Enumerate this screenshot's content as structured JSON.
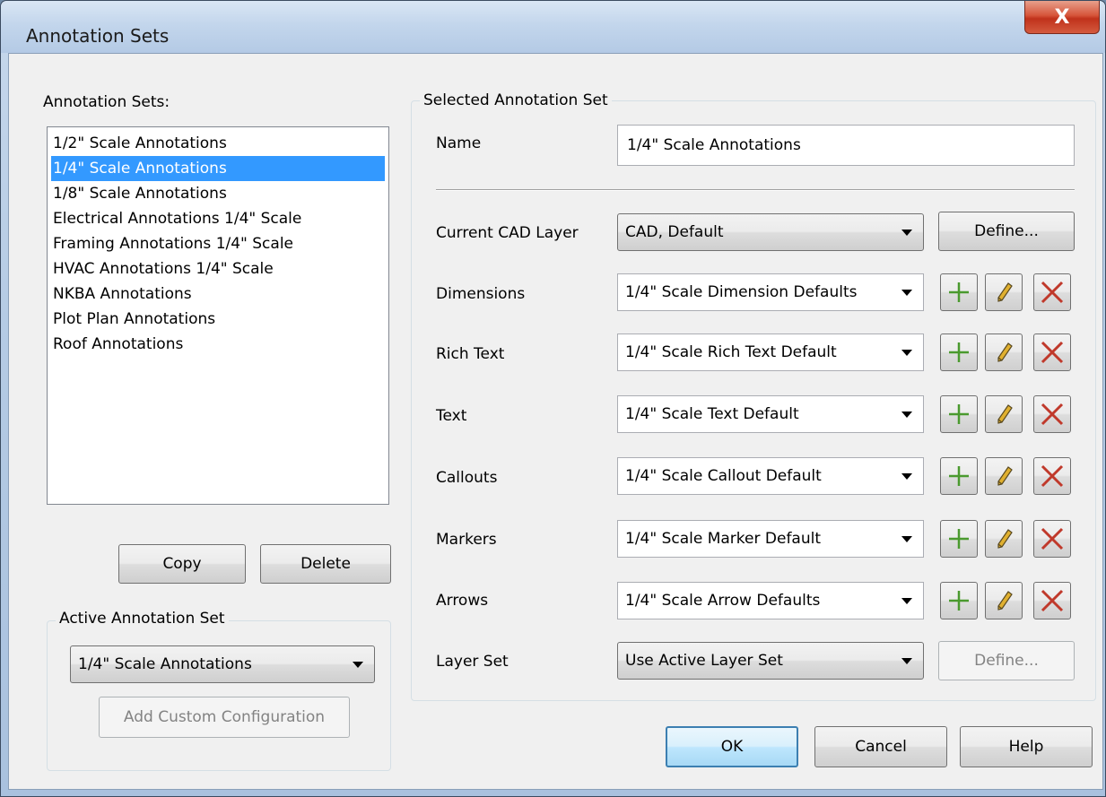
{
  "window": {
    "title": "Annotation Sets",
    "close_glyph": "X"
  },
  "left": {
    "list_label": "Annotation Sets:",
    "items": [
      "1/2\" Scale Annotations",
      "1/4\" Scale Annotations",
      "1/8\" Scale Annotations",
      "Electrical Annotations 1/4\" Scale",
      "Framing Annotations 1/4\" Scale",
      "HVAC Annotations 1/4\" Scale",
      "NKBA Annotations",
      "Plot Plan Annotations",
      "Roof Annotations"
    ],
    "selected_index": 1,
    "copy_label": "Copy",
    "delete_label": "Delete",
    "active_group_title": "Active Annotation Set",
    "active_value": "1/4\" Scale Annotations",
    "add_custom_label": "Add Custom Configuration"
  },
  "right": {
    "group_title": "Selected Annotation Set",
    "name_label": "Name",
    "name_value": "1/4\" Scale Annotations",
    "cad_layer_label": "Current CAD Layer",
    "cad_layer_value": "CAD,  Default",
    "define_label": "Define...",
    "rows": [
      {
        "label": "Dimensions",
        "value": "1/4\" Scale Dimension Defaults"
      },
      {
        "label": "Rich Text",
        "value": "1/4\" Scale Rich Text Default"
      },
      {
        "label": "Text",
        "value": "1/4\" Scale Text Default"
      },
      {
        "label": "Callouts",
        "value": "1/4\" Scale Callout Default"
      },
      {
        "label": "Markers",
        "value": "1/4\" Scale Marker Default"
      },
      {
        "label": "Arrows",
        "value": "1/4\" Scale Arrow Defaults"
      }
    ],
    "layer_set_label": "Layer Set",
    "layer_set_value": "Use Active Layer Set",
    "layer_define_label": "Define..."
  },
  "footer": {
    "ok_label": "OK",
    "cancel_label": "Cancel",
    "help_label": "Help"
  },
  "colors": {
    "selection": "#3399ff",
    "add_icon": "#4a9a2e",
    "delete_icon": "#c0392b",
    "edit_icon": "#e0b030"
  }
}
